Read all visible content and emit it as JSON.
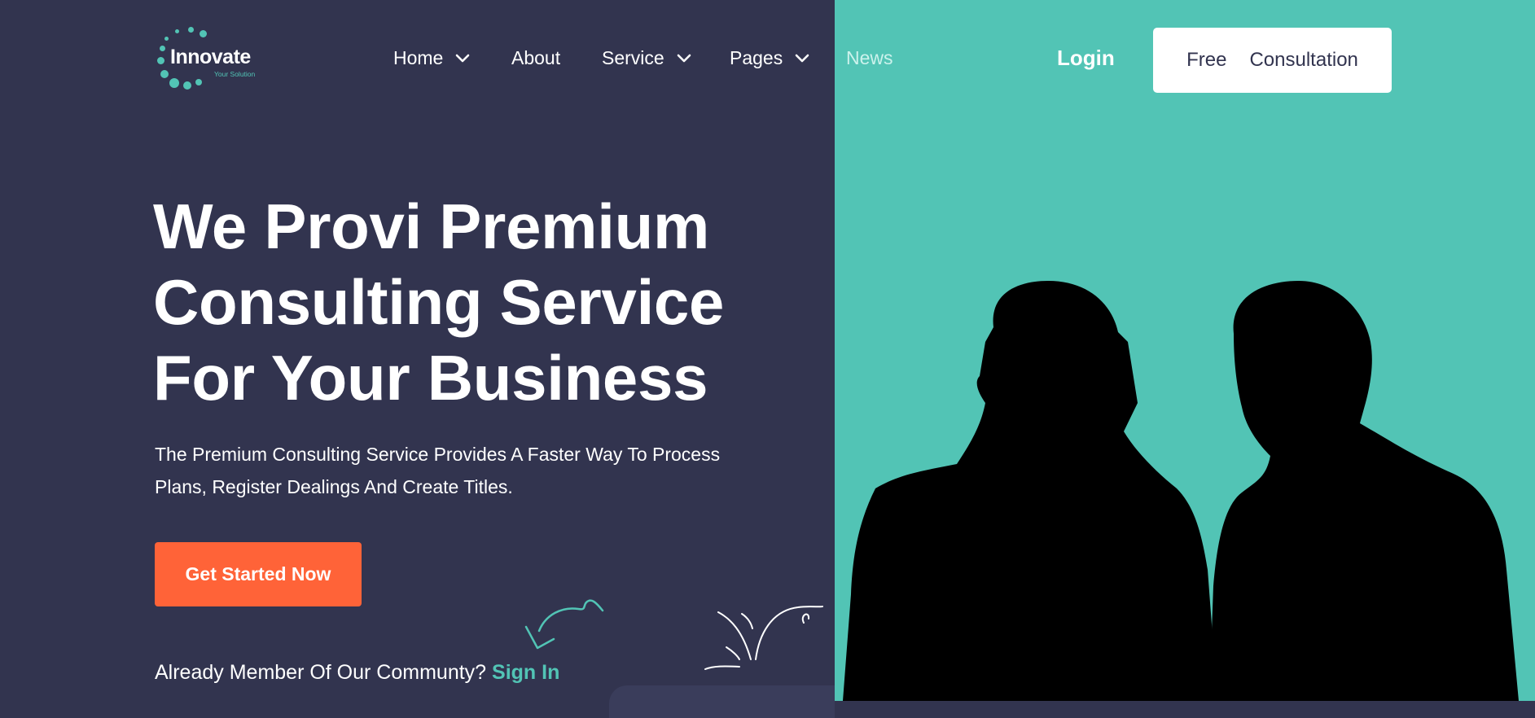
{
  "brand": {
    "name": "Innovate",
    "tagline": "Your Solution"
  },
  "nav": {
    "items": [
      {
        "label": "Home",
        "has_dropdown": true
      },
      {
        "label": "About",
        "has_dropdown": false
      },
      {
        "label": "Service",
        "has_dropdown": true
      },
      {
        "label": "Pages",
        "has_dropdown": true
      },
      {
        "label": "News",
        "has_dropdown": false
      }
    ],
    "login": "Login",
    "consult": {
      "word1": "Free",
      "word2": "Consultation"
    }
  },
  "hero": {
    "title_lines": [
      "We Provi Premium",
      "Consulting Service",
      "For Your Business"
    ],
    "description": "The Premium Consulting Service Provides A Faster Way To Process Plans, Register Dealings And Create Titles.",
    "cta": "Get Started Now",
    "member_text": "Already Member Of Our Communty?",
    "signin": "Sign In"
  },
  "colors": {
    "navy": "#32344f",
    "teal": "#52c4b5",
    "orange": "#ff6338",
    "white": "#ffffff"
  },
  "icons": [
    "chevron-down-icon",
    "curved-arrow-icon",
    "sparkle-doodle-icon"
  ]
}
